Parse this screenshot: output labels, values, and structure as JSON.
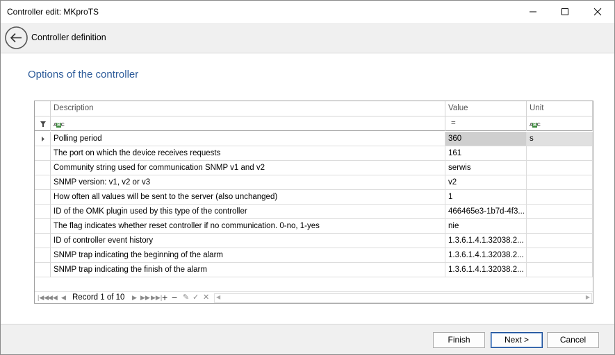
{
  "window": {
    "title": "Controller edit: MKproTS"
  },
  "header": {
    "title": "Controller definition"
  },
  "section": {
    "title": "Options of the controller"
  },
  "grid": {
    "columns": [
      "Description",
      "Value",
      "Unit"
    ],
    "filter": {
      "value_operator": "="
    },
    "rows": [
      {
        "description": "Polling period",
        "value": "360",
        "unit": "s"
      },
      {
        "description": "The port on which the device receives requests",
        "value": "161",
        "unit": ""
      },
      {
        "description": "Community string used for communication SNMP v1 and v2",
        "value": "serwis",
        "unit": ""
      },
      {
        "description": "SNMP version: v1, v2 or v3",
        "value": "v2",
        "unit": ""
      },
      {
        "description": "How often all values will be sent to the server (also unchanged)",
        "value": "1",
        "unit": ""
      },
      {
        "description": "ID of the OMK plugin used by this type of the controller",
        "value": "466465e3-1b7d-4f3...",
        "unit": ""
      },
      {
        "description": "The flag indicates whether reset controller if no communication. 0-no, 1-yes",
        "value": "nie",
        "unit": ""
      },
      {
        "description": "ID of controller event history",
        "value": "1.3.6.1.4.1.32038.2...",
        "unit": ""
      },
      {
        "description": "SNMP trap indicating the beginning of the alarm",
        "value": "1.3.6.1.4.1.32038.2...",
        "unit": ""
      },
      {
        "description": "SNMP trap indicating the finish of the alarm",
        "value": "1.3.6.1.4.1.32038.2...",
        "unit": ""
      }
    ],
    "navigator": {
      "record_text": "Record 1 of 10"
    }
  },
  "footer": {
    "finish_label": "Finish",
    "next_label": "Next >",
    "cancel_label": "Cancel"
  },
  "colors": {
    "section_title": "#2e5c9a",
    "selected_value": "#cfcfcf"
  }
}
